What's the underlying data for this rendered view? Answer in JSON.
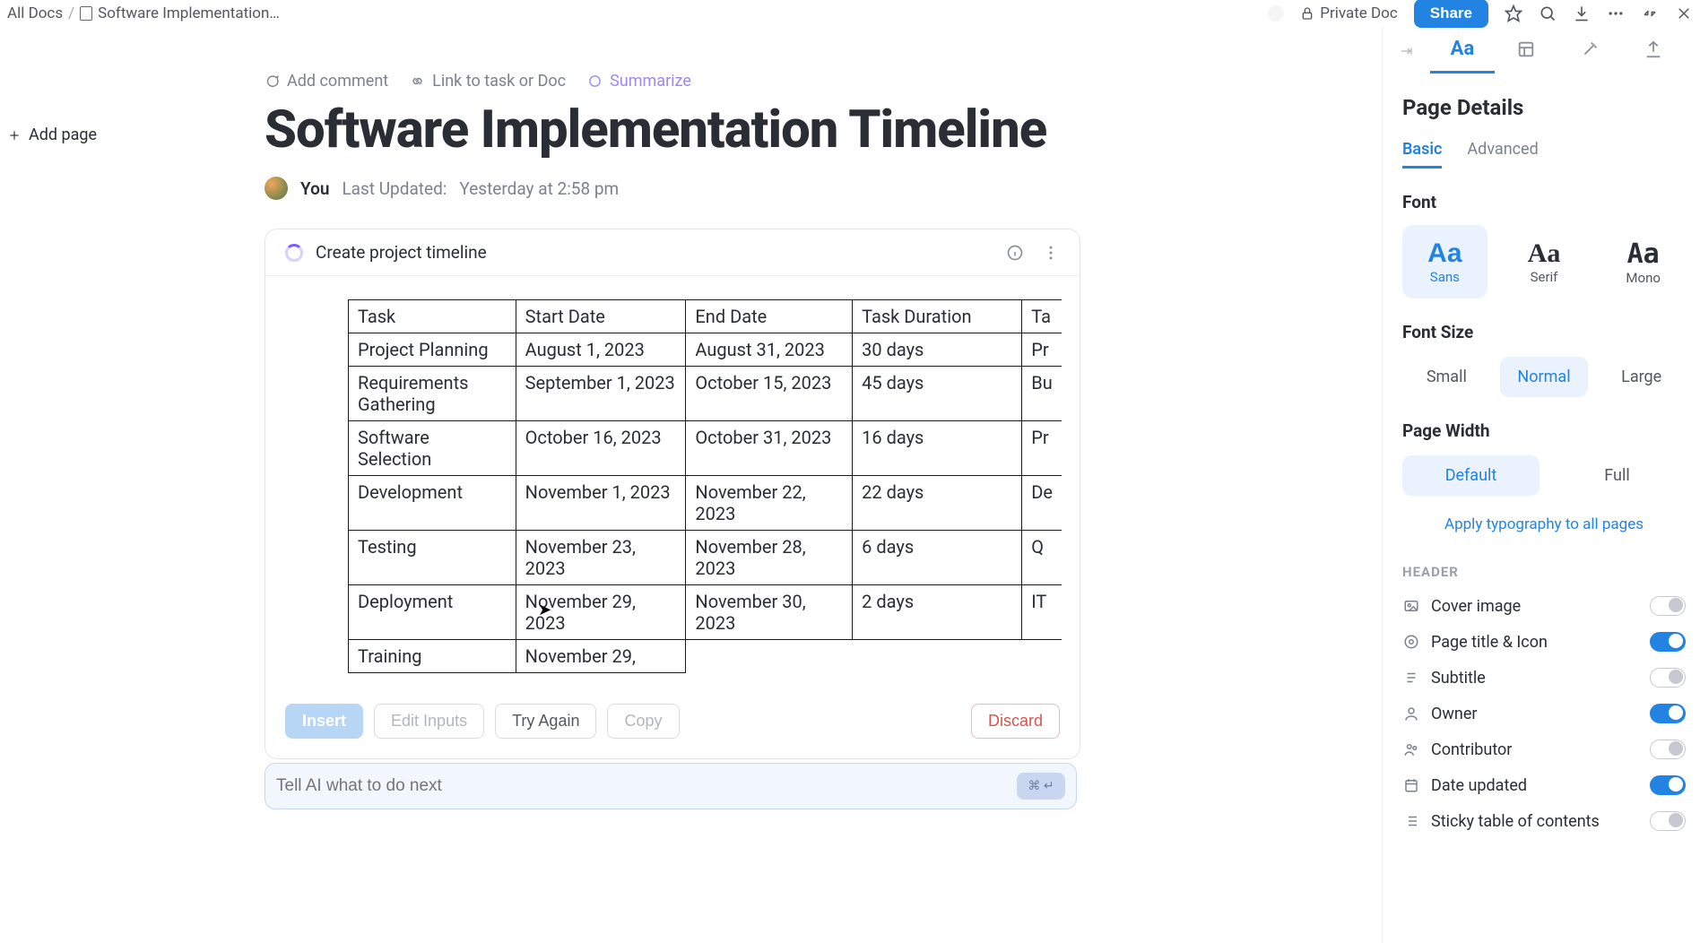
{
  "breadcrumb": {
    "root": "All Docs",
    "current": "Software Implementation…"
  },
  "topbar": {
    "private_label": "Private Doc",
    "share_label": "Share"
  },
  "left": {
    "add_page": "Add page"
  },
  "icon_tabs": {
    "aa": "Aa"
  },
  "doc_actions": {
    "add_comment": "Add comment",
    "link": "Link to task or Doc",
    "summarize": "Summarize"
  },
  "page": {
    "title": "Software Implementation Timeline",
    "author": "You",
    "last_updated_label": "Last Updated:",
    "last_updated_value": "Yesterday at 2:58 pm"
  },
  "ai_block": {
    "prompt": "Create project timeline",
    "table_headers": [
      "Task",
      "Start Date",
      "End Date",
      "Task Duration",
      "Ta"
    ],
    "rows": [
      {
        "task": "Project Planning",
        "start": "August 1, 2023",
        "end": "August 31, 2023",
        "dur": "30 days",
        "last": "Pr"
      },
      {
        "task": "Requirements Gathering",
        "start": "September 1, 2023",
        "end": "October 15, 2023",
        "dur": "45 days",
        "last": "Bu"
      },
      {
        "task": "Software Selection",
        "start": "October 16, 2023",
        "end": "October 31, 2023",
        "dur": "16 days",
        "last": "Pr"
      },
      {
        "task": "Development",
        "start": "November 1, 2023",
        "end": "November 22, 2023",
        "dur": "22 days",
        "last": "De"
      },
      {
        "task": "Testing",
        "start": "November 23, 2023",
        "end": "November 28, 2023",
        "dur": "6 days",
        "last": "Q"
      },
      {
        "task": "Deployment",
        "start": "November 29, 2023",
        "end": "November 30, 2023",
        "dur": "2 days",
        "last": "IT"
      },
      {
        "task": "Training",
        "start": "November 29,",
        "end": "",
        "dur": "",
        "last": ""
      }
    ],
    "buttons": {
      "insert": "Insert",
      "edit": "Edit Inputs",
      "try": "Try Again",
      "copy": "Copy",
      "discard": "Discard"
    },
    "input_placeholder": "Tell AI what to do next"
  },
  "sidepanel": {
    "title": "Page Details",
    "tabs": {
      "basic": "Basic",
      "advanced": "Advanced"
    },
    "font_label": "Font",
    "fonts": {
      "sans": "Sans",
      "serif": "Serif",
      "mono": "Mono"
    },
    "font_size_label": "Font Size",
    "sizes": {
      "small": "Small",
      "normal": "Normal",
      "large": "Large"
    },
    "page_width_label": "Page Width",
    "widths": {
      "default": "Default",
      "full": "Full"
    },
    "apply_link": "Apply typography to all pages",
    "header_label": "HEADER",
    "options": {
      "cover": "Cover image",
      "title_icon": "Page title & Icon",
      "subtitle": "Subtitle",
      "owner": "Owner",
      "contributor": "Contributor",
      "date_updated": "Date updated",
      "sticky_toc": "Sticky table of contents"
    }
  }
}
